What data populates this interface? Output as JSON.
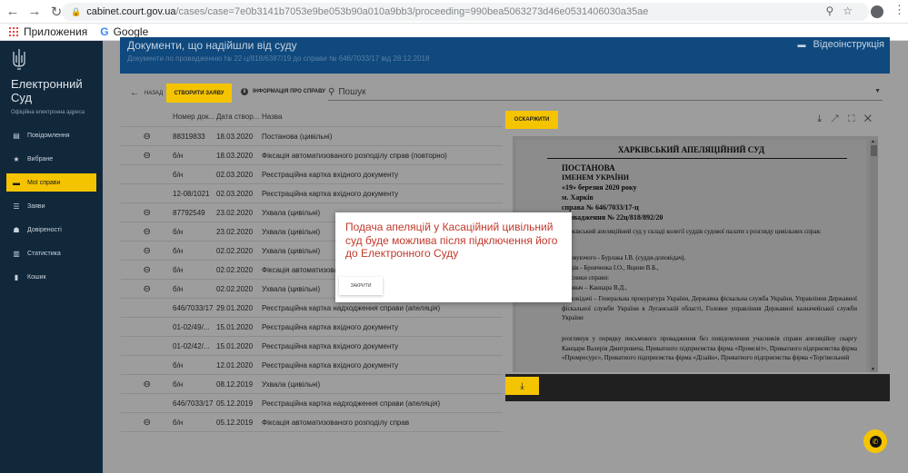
{
  "browser": {
    "url_host": "cabinet.court.gov.ua",
    "url_path": "/cases/case=7e0b3141b7053e9be053b90a010a9bb3/proceeding=990bea5063273d46e0531406030a35ae",
    "bookmark_apps": "Приложения",
    "bookmark_google": "Google"
  },
  "sidebar": {
    "brand_line1": "Електронний",
    "brand_line2": "Суд",
    "subtitle": "Офіційна електронна адреса",
    "items": [
      {
        "label": "Повідомлення"
      },
      {
        "label": "Вибране"
      },
      {
        "label": "Мої справи"
      },
      {
        "label": "Заяви"
      },
      {
        "label": "Довіреності"
      },
      {
        "label": "Статистика"
      },
      {
        "label": "Кошик"
      }
    ]
  },
  "banner": {
    "title": "Документи, що надійшли від суду",
    "subtitle": "Документи по провадженню № 22-ц/818/6387/19 до справи № 646/7033/17 від 28.12.2018",
    "video": "Відеоінструкція"
  },
  "toolbar": {
    "back": "НАЗАД",
    "create": "СТВОРИТИ ЗАЯВУ",
    "info": "ІНФОРМАЦІЯ ПРО СПРАВУ",
    "search_placeholder": "Пошук"
  },
  "table": {
    "headers": [
      "Номер док...",
      "Дата створ...",
      "Назва"
    ],
    "rows": [
      {
        "num": "88319833",
        "date": "18.03.2020",
        "name": "Постанова (цивільні)"
      },
      {
        "num": "б/н",
        "date": "18.03.2020",
        "name": "Фіксація автоматизованого розподілу справ (повторно)"
      },
      {
        "num": "б/н",
        "date": "02.03.2020",
        "name": "Реєстраційна картка вхідного документу"
      },
      {
        "num": "12-08/1021",
        "date": "02.03.2020",
        "name": "Реєстраційна картка вхідного документу"
      },
      {
        "num": "87792549",
        "date": "23.02.2020",
        "name": "Ухвала (цивільні)"
      },
      {
        "num": "б/н",
        "date": "23.02.2020",
        "name": "Ухвала (цивільні)"
      },
      {
        "num": "б/н",
        "date": "02.02.2020",
        "name": "Ухвала (цивільні)"
      },
      {
        "num": "б/н",
        "date": "02.02.2020",
        "name": "Фіксація автоматизованого розподілу справ"
      },
      {
        "num": "б/н",
        "date": "02.02.2020",
        "name": "Ухвала (цивільні)"
      },
      {
        "num": "646/7033/17",
        "date": "29.01.2020",
        "name": "Реєстраційна картка надходження справи (апеляція)"
      },
      {
        "num": "01-02/49/...",
        "date": "15.01.2020",
        "name": "Реєстраційна картка вхідного документу"
      },
      {
        "num": "01-02/42/...",
        "date": "15.01.2020",
        "name": "Реєстраційна картка вхідного документу"
      },
      {
        "num": "б/н",
        "date": "12.01.2020",
        "name": "Реєстраційна картка вхідного документу"
      },
      {
        "num": "б/н",
        "date": "08.12.2019",
        "name": "Ухвала (цивільні)"
      },
      {
        "num": "646/7033/17",
        "date": "05.12.2019",
        "name": "Реєстраційна картка надходження справи (апеляція)"
      },
      {
        "num": "б/н",
        "date": "05.12.2019",
        "name": "Фіксація автоматизованого розподілу справ"
      }
    ]
  },
  "viewer": {
    "appeal": "ОСКАРЖИТИ",
    "doc": {
      "court": "ХАРКІВСЬКИЙ АПЕЛЯЦІЙНИЙ СУД",
      "type": "ПОСТАНОВА",
      "name": "ІМЕНЕМ  УКРАЇНИ",
      "date": "«19» березня 2020 року",
      "city": "м. Харків",
      "case": "справа № 646/7033/17-ц",
      "proc": "провадження № 22ц/818/892/20",
      "p1": "Харківський апеляційний суд у складі колегії суддів судової палати з розгляду цивільних справ:",
      "p2": "головуючого -        Бурлака І.В. (суддя-доповідач),",
      "p3": "суддів -        Бровченка І.О., Яцини В.Б.,",
      "p4": "учасники справи:",
      "p5": "позивач – Канцара В.Д.,",
      "p6": "відповідачі – Генеральна прокуратура України, Державна фіскальна служба України, Управління Державної фіскальної служби України в Луганській області, Головне управління Державної казначейської служби України",
      "p7": "розглянув у порядку письмового провадження без повідомлення учасників справи апеляційну скаргу Канцари Валерія Дмитровича, Приватного підприємства фірма «Промсвіт», Приватного підприємства фірма «Промресурс», Приватного підприємства фірма «Дізайн», Приватного підприємства фірма «Торгівельний"
    }
  },
  "modal": {
    "message": "Подача апеляцій у Касаційний цивільний суд буде можлива після підключення його до Електронного Суду",
    "close": "ЗАКРИТИ"
  }
}
